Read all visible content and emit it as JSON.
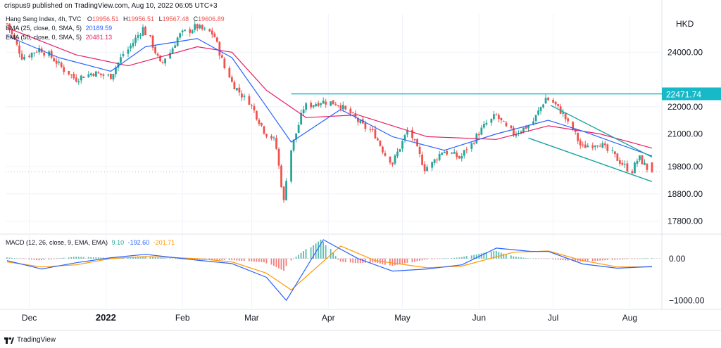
{
  "header": {
    "publisher_line": "crispus9 published on TradingView.com, Aug 10, 2022 06:05 UTC+3"
  },
  "footer": {
    "brand": "TradingView"
  },
  "colors": {
    "up": "#26a69a",
    "down": "#ef5350",
    "ema25": "#2962ff",
    "ema50": "#e91e63",
    "trend": "#17a2a0",
    "resistance": "#17b8c8",
    "macd": "#2962ff",
    "signal": "#ff9800"
  },
  "legend": {
    "main": {
      "name": "Hang Seng Index, 4h, TVC",
      "o_label": "O",
      "o": "19956.51",
      "h_label": "H",
      "h": "19956.51",
      "l_label": "L",
      "l": "19567.48",
      "c_label": "C",
      "c": "19606.89"
    },
    "ema25": {
      "label": "EMA (25, close, 0, SMA, 5)",
      "value": "20189.59"
    },
    "ema50": {
      "label": "EMA (50, close, 0, SMA, 5)",
      "value": "20481.13"
    },
    "macd": {
      "label": "MACD (12, 26, close, 9, EMA, EMA)",
      "hist": "9.10",
      "macd": "-192.60",
      "signal": "-201.71"
    }
  },
  "chart_data": {
    "type": "candlestick",
    "title": "Hang Seng Index, 4h, TVC",
    "currency": "HKD",
    "price_axis": {
      "ticks": [
        "24000.00",
        "22000.00",
        "21000.00",
        "19800.00",
        "18800.00",
        "17800.00"
      ],
      "tick_values": [
        24000,
        22000,
        21000,
        19800,
        18800,
        17800
      ],
      "range": [
        17400,
        25400
      ]
    },
    "macd_axis": {
      "ticks": [
        "0.00",
        "−1000.00"
      ],
      "tick_values": [
        0,
        -1000
      ],
      "range": [
        -1180,
        500
      ]
    },
    "x_labels": [
      "Dec",
      "2022",
      "Feb",
      "Mar",
      "Apr",
      "May",
      "Jun",
      "Jul",
      "Aug"
    ],
    "resistance": {
      "value": 22471.74,
      "label": "22471.74"
    },
    "channel": {
      "upper": [
        [
          "2022-06-30",
          22050
        ],
        [
          "2022-08-10",
          20150
        ]
      ],
      "lower": [
        [
          "2022-06-21",
          20850
        ],
        [
          "2022-08-10",
          19250
        ]
      ]
    },
    "price_path": [
      [
        "2021-11-22",
        25050
      ],
      [
        "2021-11-29",
        23800
      ],
      [
        "2021-12-06",
        24150
      ],
      [
        "2021-12-13",
        23600
      ],
      [
        "2021-12-20",
        23000
      ],
      [
        "2021-12-27",
        23250
      ],
      [
        "2022-01-03",
        23100
      ],
      [
        "2022-01-10",
        24100
      ],
      [
        "2022-01-17",
        24900
      ],
      [
        "2022-01-24",
        23500
      ],
      [
        "2022-01-31",
        24600
      ],
      [
        "2022-02-07",
        24950
      ],
      [
        "2022-02-14",
        24650
      ],
      [
        "2022-02-21",
        22900
      ],
      [
        "2022-02-28",
        22200
      ],
      [
        "2022-03-07",
        21100
      ],
      [
        "2022-03-11",
        20700
      ],
      [
        "2022-03-15",
        18400
      ],
      [
        "2022-03-17",
        20400
      ],
      [
        "2022-03-23",
        22000
      ],
      [
        "2022-03-30",
        22200
      ],
      [
        "2022-04-06",
        22100
      ],
      [
        "2022-04-13",
        21500
      ],
      [
        "2022-04-20",
        21000
      ],
      [
        "2022-04-27",
        19900
      ],
      [
        "2022-05-04",
        21100
      ],
      [
        "2022-05-11",
        19700
      ],
      [
        "2022-05-18",
        20400
      ],
      [
        "2022-05-25",
        20100
      ],
      [
        "2022-06-01",
        21000
      ],
      [
        "2022-06-08",
        21700
      ],
      [
        "2022-06-15",
        21000
      ],
      [
        "2022-06-22",
        21300
      ],
      [
        "2022-06-29",
        22350
      ],
      [
        "2022-07-06",
        21700
      ],
      [
        "2022-07-13",
        20500
      ],
      [
        "2022-07-20",
        20700
      ],
      [
        "2022-07-27",
        20100
      ],
      [
        "2022-08-02",
        19650
      ],
      [
        "2022-08-05",
        20150
      ],
      [
        "2022-08-10",
        19606
      ]
    ],
    "ema25_path": [
      [
        "2021-11-22",
        24600
      ],
      [
        "2021-12-13",
        23800
      ],
      [
        "2022-01-03",
        23300
      ],
      [
        "2022-01-17",
        24200
      ],
      [
        "2022-02-07",
        24500
      ],
      [
        "2022-02-21",
        23800
      ],
      [
        "2022-03-07",
        22000
      ],
      [
        "2022-03-17",
        20700
      ],
      [
        "2022-04-06",
        21900
      ],
      [
        "2022-04-27",
        20900
      ],
      [
        "2022-05-18",
        20400
      ],
      [
        "2022-06-08",
        21000
      ],
      [
        "2022-06-29",
        21500
      ],
      [
        "2022-07-13",
        21100
      ],
      [
        "2022-08-10",
        20190
      ]
    ],
    "ema50_path": [
      [
        "2021-11-22",
        24900
      ],
      [
        "2021-12-20",
        23900
      ],
      [
        "2022-01-10",
        23500
      ],
      [
        "2022-02-07",
        24200
      ],
      [
        "2022-02-21",
        24000
      ],
      [
        "2022-03-07",
        22600
      ],
      [
        "2022-03-23",
        21600
      ],
      [
        "2022-04-13",
        21700
      ],
      [
        "2022-05-11",
        20900
      ],
      [
        "2022-06-08",
        20800
      ],
      [
        "2022-06-29",
        21300
      ],
      [
        "2022-07-20",
        21000
      ],
      [
        "2022-08-10",
        20480
      ]
    ],
    "macd_path": [
      [
        "2021-11-22",
        -50
      ],
      [
        "2021-12-06",
        -250
      ],
      [
        "2021-12-20",
        -100
      ],
      [
        "2022-01-03",
        20
      ],
      [
        "2022-01-17",
        100
      ],
      [
        "2022-02-07",
        -40
      ],
      [
        "2022-02-21",
        -120
      ],
      [
        "2022-03-07",
        -450
      ],
      [
        "2022-03-15",
        -1000
      ],
      [
        "2022-03-30",
        450
      ],
      [
        "2022-04-13",
        0
      ],
      [
        "2022-04-27",
        -300
      ],
      [
        "2022-05-11",
        -250
      ],
      [
        "2022-05-25",
        -150
      ],
      [
        "2022-06-08",
        250
      ],
      [
        "2022-06-22",
        170
      ],
      [
        "2022-06-29",
        170
      ],
      [
        "2022-07-13",
        -130
      ],
      [
        "2022-07-27",
        -230
      ],
      [
        "2022-08-10",
        -190
      ]
    ],
    "signal_path": [
      [
        "2021-11-22",
        -80
      ],
      [
        "2021-12-06",
        -200
      ],
      [
        "2021-12-20",
        -150
      ],
      [
        "2022-01-03",
        0
      ],
      [
        "2022-01-17",
        50
      ],
      [
        "2022-02-07",
        0
      ],
      [
        "2022-02-21",
        -80
      ],
      [
        "2022-03-07",
        -350
      ],
      [
        "2022-03-17",
        -750
      ],
      [
        "2022-04-06",
        300
      ],
      [
        "2022-04-20",
        -50
      ],
      [
        "2022-05-11",
        -220
      ],
      [
        "2022-05-25",
        -180
      ],
      [
        "2022-06-15",
        150
      ],
      [
        "2022-06-29",
        180
      ],
      [
        "2022-07-13",
        -50
      ],
      [
        "2022-07-27",
        -200
      ],
      [
        "2022-08-10",
        -200
      ]
    ]
  }
}
